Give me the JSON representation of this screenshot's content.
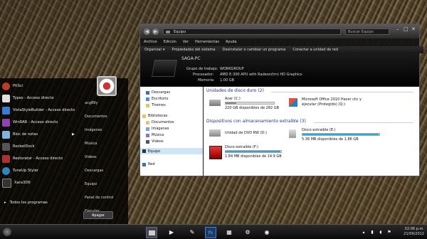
{
  "start_menu": {
    "programs": [
      {
        "label": "PtiSci",
        "color": "#c0392b"
      },
      {
        "label": "Types - Acceso directo",
        "color": "#e0e0e0"
      },
      {
        "label": "VistaStyleBuilder - Acceso directo",
        "color": "#3a7bd5"
      },
      {
        "label": "WinRAR - Acceso directo",
        "color": "#8e44ad"
      },
      {
        "label": "Bloc de notas",
        "color": "#7fb3e0",
        "arrow": "▶"
      },
      {
        "label": "RocketDock",
        "color": "#555555"
      },
      {
        "label": "Restorator - Acceso directo",
        "color": "#b03030"
      },
      {
        "label": "TuneUp Styler",
        "color": "#2e86c1"
      },
      {
        "label": "Xara3D6",
        "color": "#333333"
      }
    ],
    "all_programs": "Todos los programas",
    "right_items": [
      "acg89y",
      "Documentos",
      "Imágenes",
      "Música",
      "Videos",
      "Descargas",
      "Equipo",
      "Panel de control",
      "Ejecutar..."
    ],
    "shutdown_label": "Apagar"
  },
  "explorer": {
    "address": "Equipo",
    "search_placeholder": "Buscar Equipo",
    "menu": [
      "Archivo",
      "Edición",
      "Ver",
      "Herramientas",
      "Ayuda"
    ],
    "toolbar": [
      "Organizar ▾",
      "Propiedades del sistema",
      "Desinstalar o cambiar un programa",
      "Conectar a unidad de red"
    ],
    "pc_name": "SAGA-PC",
    "workgroup_label": "Grupo de trabajo:",
    "workgroup_value": "WORKGROUP",
    "processor_label": "Procesador:",
    "processor_value": "AMD E-300 APU with Radeon(tm) HD Graphics",
    "memory_label": "Memoria:",
    "memory_value": "1.00 GB",
    "nav": {
      "favorites": [
        "Descargas",
        "Escritorio",
        "Themes"
      ],
      "libraries_label": "Bibliotecas",
      "libraries": [
        "Documentos",
        "Imágenes",
        "Música",
        "Videos"
      ],
      "computer_label": "Equipo",
      "network_label": "Red"
    },
    "hdd_section": "Unidades de disco duro (2)",
    "removable_section": "Dispositivos con almacenamiento extraíble (3)",
    "drives": {
      "c": {
        "name": "Acer (C:)",
        "free": "220 GB disponibles de 282 GB",
        "used_fraction": 0.22
      },
      "d_office": {
        "name": "Microsoft Office 2010 Hacer clic y",
        "line2": "ejecutar (Protegido) (Q:)"
      },
      "dvd": {
        "name": "Unidad de DVD RW (D:)"
      },
      "e": {
        "name": "Disco extraíble (E:)",
        "free": "5.36 MB disponibles de 1.86 GB",
        "used_fraction": 0.99
      },
      "f": {
        "name": "Disco extraíble (F:)",
        "free": "1.84 MB disponibles de 14.9 GB",
        "used_fraction": 0.99
      }
    }
  },
  "taskbar": {
    "time": "02:06 p.m.",
    "date": "21/09/2012"
  },
  "colors": {
    "accent": "#2aa7d8",
    "section": "#1e3287"
  }
}
